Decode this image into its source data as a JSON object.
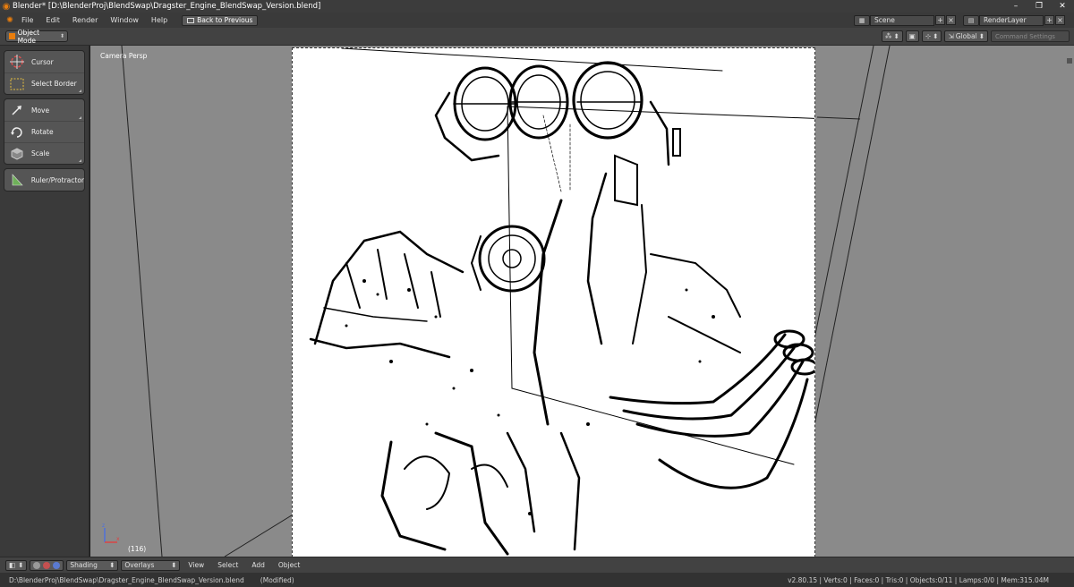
{
  "titlebar": {
    "title": "Blender* [D:\\BlenderProj\\BlendSwap\\Dragster_Engine_BlendSwap_Version.blend]",
    "minimize": "–",
    "restore": "❐",
    "close": "✕"
  },
  "menubar": {
    "items": [
      "File",
      "Edit",
      "Render",
      "Window",
      "Help"
    ],
    "back_label": "Back to Previous",
    "scene_value": "Scene",
    "renderlayer_value": "RenderLayer"
  },
  "header": {
    "mode": "Object Mode",
    "orientation": "Global",
    "command_placeholder": "Command Settings"
  },
  "toolshelf": {
    "tools": [
      {
        "label": "Cursor"
      },
      {
        "label": "Select Border"
      },
      {
        "label": "Move"
      },
      {
        "label": "Rotate"
      },
      {
        "label": "Scale"
      },
      {
        "label": "Ruler/Protractor"
      }
    ]
  },
  "viewport": {
    "view_label": "Camera Persp",
    "frame": "(116)"
  },
  "footer": {
    "shading": "Shading",
    "overlays": "Overlays",
    "menus": [
      "View",
      "Select",
      "Add",
      "Object"
    ]
  },
  "status": {
    "filepath": "D:\\BlenderProj\\BlendSwap\\Dragster_Engine_BlendSwap_Version.blend",
    "modified": "(Modified)",
    "stats": "v2.80.15 | Verts:0 | Faces:0 | Tris:0 | Objects:0/11 | Lamps:0/0 | Mem:315.04M"
  },
  "colors": {
    "accent": "#e87d0d",
    "viewport_bg": "#8a8a8a",
    "camera_bg": "#ffffff"
  }
}
